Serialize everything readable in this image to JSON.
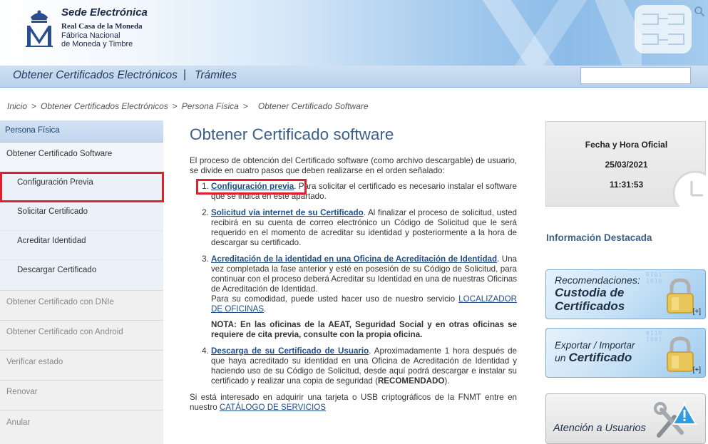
{
  "header": {
    "title": "Sede Electrónica",
    "org_line1": "Real Casa de la Moneda",
    "org_line2": "Fábrica Nacional",
    "org_line3": "de Moneda y Timbre"
  },
  "nav": {
    "item1": "Obtener Certificados Electrónicos",
    "separator": "|",
    "item2": "Trámites",
    "search_placeholder": ""
  },
  "breadcrumb": [
    "Inicio",
    "Obtener Certificados Electrónicos",
    "Persona Física",
    "Obtener Certificado Software"
  ],
  "breadcrumb_sep": ">",
  "sidebar": {
    "header": "Persona Física",
    "items": [
      {
        "label": "Obtener Certificado Software"
      },
      {
        "label": "Configuración Previa"
      },
      {
        "label": "Solicitar Certificado"
      },
      {
        "label": "Acreditar Identidad"
      },
      {
        "label": "Descargar Certificado"
      },
      {
        "label": "Obtener Certificado con DNIe"
      },
      {
        "label": "Obtener Certificado con Android"
      },
      {
        "label": "Verificar estado"
      },
      {
        "label": "Renovar"
      },
      {
        "label": "Anular"
      }
    ]
  },
  "main": {
    "title": "Obtener Certificado software",
    "intro": "El proceso de obtención del Certificado software (como archivo descargable) de usuario, se divide en cuatro pasos que deben realizarse en el orden señalado:",
    "steps": [
      {
        "link": "Configuración previa",
        "text": " Para solicitar el certificado es necesario instalar el software que se indica en este apartado."
      },
      {
        "link": "Solicitud vía internet de su Certificado",
        "text": " Al finalizar el proceso de solicitud, usted recibirá en su cuenta de correo electrónico un Código de Solicitud que le será requerido en el momento de acreditar su identidad y posteriormente a la hora de descargar su certificado."
      },
      {
        "link": "Acreditación de la identidad en una Oficina de Acreditación de Identidad",
        "text": " Una vez completada la fase anterior y esté en posesión de su Código de Solicitud, para continuar con el proceso deberá Acreditar su Identidad en una de nuestras Oficinas de Acreditación de Identidad.",
        "text2": "Para su comodidad, puede usted hacer uso de nuestro servicio ",
        "link2": "LOCALIZADOR DE OFICINAS",
        "note": "NOTA: En las oficinas de la AEAT, Seguridad Social y en otras oficinas se requiere de cita previa, consulte con la propia oficina."
      },
      {
        "link": "Descarga de su Certificado de Usuario",
        "text": " Aproximadamente 1 hora después de que haya acreditado su identidad en una Oficina de Acreditación de Identidad y haciendo uso de su Código de Solicitud, desde aquí podrá descargar e instalar su certificado y realizar una copia de seguridad (",
        "bold": "RECOMENDADO",
        "text_end": ")."
      }
    ],
    "final_text": "Si está interesado en adquirir una tarjeta o USB criptográficos de la FNMT entre en nuestro ",
    "final_link": "CATÁLOGO DE SERVICIOS"
  },
  "right": {
    "clock_title": "Fecha y Hora Oficial",
    "date": "25/03/2021",
    "time": "11:31:53",
    "info_title": "Información Destacada",
    "promo1_line1": "Recomendaciones:",
    "promo1_line2a": "Custodia de",
    "promo1_line2b": "Certificados",
    "promo2_line1": "Exportar / Importar",
    "promo2_line2a": "un ",
    "promo2_line2b": "Certificado",
    "plus": "[+]",
    "atencion": "Atención a Usuarios"
  }
}
